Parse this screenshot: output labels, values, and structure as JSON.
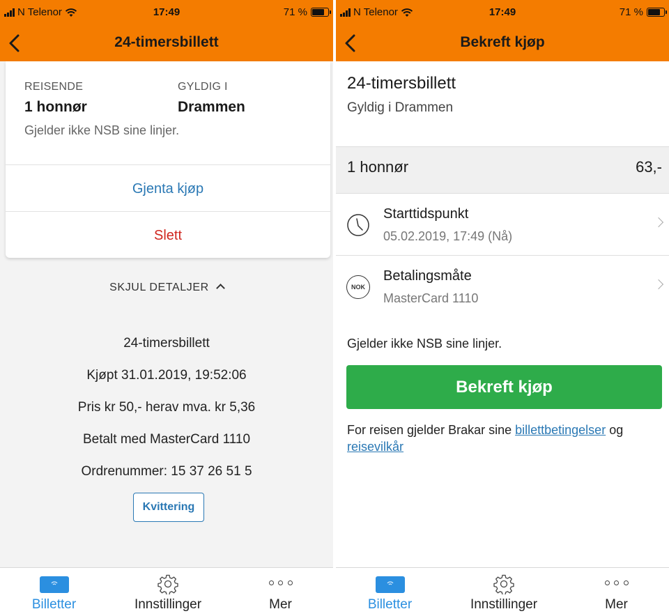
{
  "status_bar": {
    "carrier": "N Telenor",
    "time": "17:49",
    "battery": "71 %",
    "battery_level": 0.71
  },
  "left": {
    "nav_title": "24-timersbillett",
    "card": {
      "traveler_label": "REISENDE",
      "traveler_value": "1 honnør",
      "valid_label": "GYLDIG I",
      "valid_value": "Drammen",
      "note": "Gjelder ikke NSB sine linjer.",
      "repeat_label": "Gjenta kjøp",
      "delete_label": "Slett"
    },
    "details_toggle": "SKJUL DETALJER",
    "details": [
      "24-timersbillett",
      "Kjøpt 31.01.2019, 19:52:06",
      "Pris kr 50,- herav mva. kr 5,36",
      "Betalt med MasterCard 1110",
      "Ordrenummer: 15 37 26 51 5"
    ],
    "receipt_label": "Kvittering"
  },
  "right": {
    "nav_title": "Bekreft kjøp",
    "ticket_title": "24-timersbillett",
    "ticket_subtitle": "Gyldig i Drammen",
    "quantity": "1 honnør",
    "price": "63,-",
    "start_row": {
      "label": "Starttidspunkt",
      "value": "05.02.2019, 17:49 (Nå)",
      "icon": "clock-icon"
    },
    "payment_row": {
      "label": "Betalingsmåte",
      "value": "MasterCard 1110",
      "icon_text": "NOK"
    },
    "note": "Gjelder ikke NSB sine linjer.",
    "confirm_label": "Bekreft kjøp",
    "terms_prefix": "For reisen gjelder Brakar sine ",
    "terms_link1": "billettbetingelser",
    "terms_middle": " og ",
    "terms_link2": "reisevilkår"
  },
  "tabbar": {
    "tickets": "Billetter",
    "settings": "Innstillinger",
    "more": "Mer"
  },
  "colors": {
    "header": "#f47c00",
    "link": "#2a78b4",
    "danger": "#d0261f",
    "confirm": "#2eac4a",
    "tab_active": "#2b8fe0"
  }
}
